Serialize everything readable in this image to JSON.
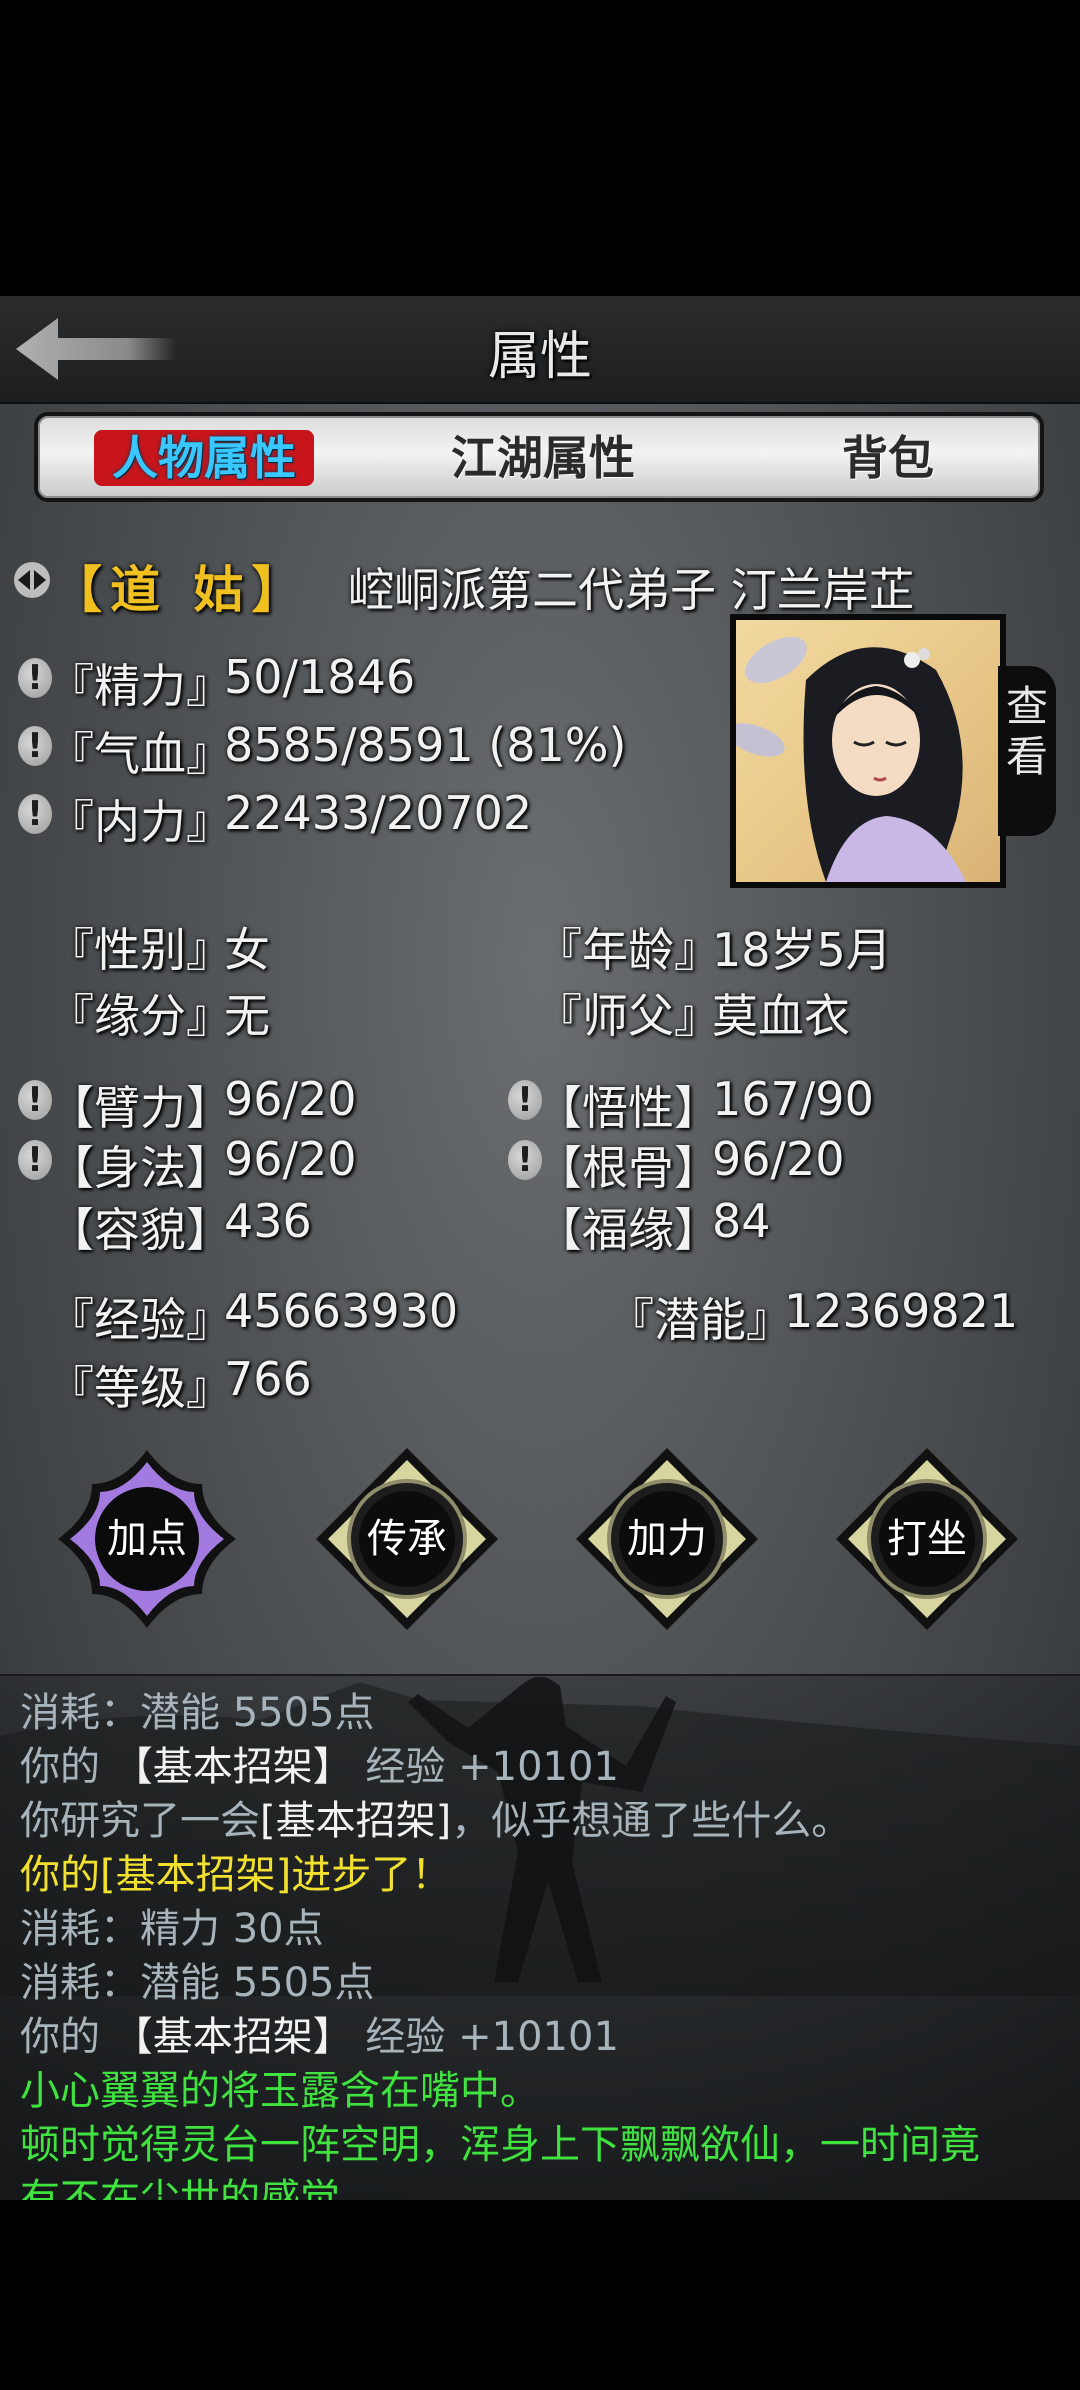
{
  "header": {
    "title": "属性"
  },
  "tabs": [
    {
      "label": "人物属性",
      "active": true
    },
    {
      "label": "江湖属性",
      "active": false
    },
    {
      "label": "背包",
      "active": false
    }
  ],
  "character": {
    "title_tag": "【道 姑】",
    "sect_name": "崆峒派第二代弟子 汀兰岸芷",
    "view_label": "查看"
  },
  "vitals": [
    {
      "label": "『精力』",
      "value": "50/1846"
    },
    {
      "label": "『气血』",
      "value": "8585/8591 (81%)"
    },
    {
      "label": "『内力』",
      "value": "22433/20702"
    }
  ],
  "info": {
    "gender_label": "『性别』",
    "gender": "女",
    "age_label": "『年龄』",
    "age": "18岁5月",
    "fate_label": "『缘分』",
    "fate": "无",
    "master_label": "『师父』",
    "master": "莫血衣"
  },
  "attributes": {
    "arm_label": "【臂力】",
    "arm": "96/20",
    "wisdom_label": "【悟性】",
    "wisdom": "167/90",
    "agility_label": "【身法】",
    "agility": "96/20",
    "bone_label": "【根骨】",
    "bone": "96/20",
    "looks_label": "【容貌】",
    "looks": "436",
    "luck_label": "【福缘】",
    "luck": "84"
  },
  "progress": {
    "exp_label": "『经验』",
    "exp": "45663930",
    "potential_label": "『潜能』",
    "potential": "12369821",
    "level_label": "『等级』",
    "level": "766"
  },
  "actions": [
    {
      "label": "加点",
      "color": "#a37be0"
    },
    {
      "label": "传承",
      "color": "#d8d6a0"
    },
    {
      "label": "加力",
      "color": "#d8d6a0"
    },
    {
      "label": "打坐",
      "color": "#d8d6a0"
    }
  ],
  "log": [
    {
      "text": "消耗：潜能 5505点",
      "color": "gray"
    },
    {
      "text": "你的 【基本招架】 经验 +10101",
      "color": "mixed"
    },
    {
      "text": "你研究了一会[基本招架]，似乎想通了些什么。",
      "color": "mixed2"
    },
    {
      "text": "你的[基本招架]进步了！",
      "color": "yellow"
    },
    {
      "text": "消耗：精力 30点",
      "color": "gray"
    },
    {
      "text": "消耗：潜能 5505点",
      "color": "gray"
    },
    {
      "text": "你的 【基本招架】 经验 +10101",
      "color": "mixed"
    },
    {
      "text": "小心翼翼的将玉露含在嘴中。",
      "color": "green"
    },
    {
      "text": "顿时觉得灵台一阵空明，浑身上下飘飘欲仙，一时间竟",
      "color": "green"
    },
    {
      "text": "有不在尘世的感觉。",
      "color": "green"
    }
  ],
  "log_parts": {
    "your": "你的 ",
    "skill_bracket": "【基本招架】",
    "exp_gain": " 经验 +10101",
    "studied_pre": "你研究了一会",
    "skill_square": "[基本招架]",
    "studied_post": "，似乎想通了些什么。"
  }
}
